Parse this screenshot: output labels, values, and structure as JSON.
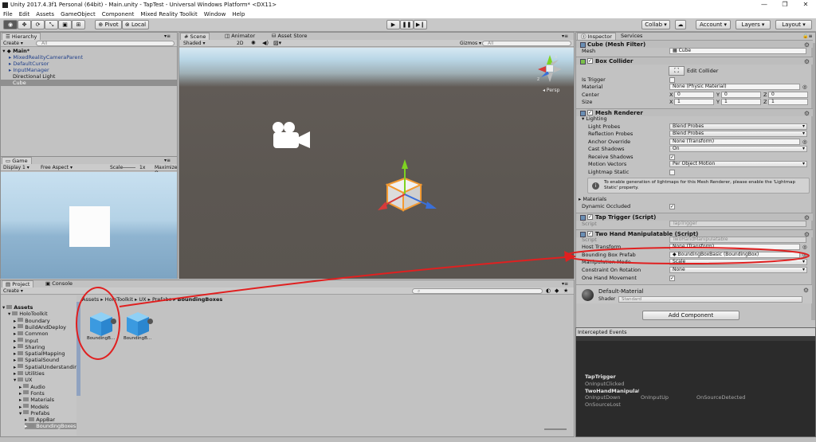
{
  "window": {
    "title": "Unity 2017.4.3f1 Personal (64bit) - Main.unity - TapTest - Universal Windows Platform* <DX11>",
    "minimize": "—",
    "maximize": "❐",
    "close": "✕"
  },
  "menu": [
    "File",
    "Edit",
    "Assets",
    "GameObject",
    "Component",
    "Mixed Reality Toolkit",
    "Window",
    "Help"
  ],
  "toolbar": {
    "pivot": "Pivot",
    "local": "Local",
    "collab": "Collab ▾",
    "account": "Account ▾",
    "layers": "Layers ▾",
    "layout": "Layout ▾"
  },
  "hierarchy": {
    "tab": "Hierarchy",
    "create": "Create ▾",
    "search": "All",
    "scene": "Main*",
    "items": [
      "MixedRealityCameraParent",
      "DefaultCursor",
      "InputManager",
      "Directional Light",
      "Cube"
    ]
  },
  "scene": {
    "tabs": [
      "Scene",
      "Animator",
      "Asset Store"
    ],
    "shading": "Shaded",
    "mode2d": "2D",
    "gizmos": "Gizmos ▾",
    "search": "All",
    "persp": "Persp",
    "gizmo_x": "x",
    "gizmo_z": "z"
  },
  "game": {
    "tab": "Game",
    "display": "Display 1",
    "aspect": "Free Aspect",
    "scale_label": "Scale",
    "scale_value": "1x",
    "maximize": "Maximize O"
  },
  "project": {
    "tabs": [
      "Project",
      "Console"
    ],
    "create": "Create ▾",
    "breadcrumb": [
      "Assets",
      "HoloToolkit",
      "UX",
      "Prefabs",
      "BoundingBoxes"
    ],
    "tree": [
      {
        "label": "Assets",
        "indent": 0,
        "bold": true,
        "expanded": true
      },
      {
        "label": "HoloToolkit",
        "indent": 1,
        "expanded": true
      },
      {
        "label": "Boundary",
        "indent": 2
      },
      {
        "label": "BuildAndDeploy",
        "indent": 2
      },
      {
        "label": "Common",
        "indent": 2
      },
      {
        "label": "Input",
        "indent": 2
      },
      {
        "label": "Sharing",
        "indent": 2
      },
      {
        "label": "SpatialMapping",
        "indent": 2
      },
      {
        "label": "SpatialSound",
        "indent": 2
      },
      {
        "label": "SpatialUnderstandin",
        "indent": 2
      },
      {
        "label": "Utilities",
        "indent": 2
      },
      {
        "label": "UX",
        "indent": 2,
        "expanded": true
      },
      {
        "label": "Audio",
        "indent": 3
      },
      {
        "label": "Fonts",
        "indent": 3
      },
      {
        "label": "Materials",
        "indent": 3
      },
      {
        "label": "Models",
        "indent": 3
      },
      {
        "label": "Prefabs",
        "indent": 3,
        "expanded": true
      },
      {
        "label": "AppBar",
        "indent": 4
      },
      {
        "label": "BoundingBoxes",
        "indent": 4,
        "selected": true
      }
    ],
    "assets": [
      {
        "label": "BoundingB..."
      },
      {
        "label": "BoundingB..."
      }
    ]
  },
  "inspector": {
    "tabs": [
      "Inspector",
      "Services"
    ],
    "mesh_filter": {
      "title": "Cube (Mesh Filter)",
      "mesh_label": "Mesh",
      "mesh_value": "Cube"
    },
    "box_collider": {
      "title": "Box Collider",
      "edit_collider": "Edit Collider",
      "is_trigger": "Is Trigger",
      "material_label": "Material",
      "material_value": "None (Physic Material)",
      "center_label": "Center",
      "size_label": "Size",
      "center": [
        "0",
        "0",
        "0"
      ],
      "size": [
        "1",
        "1",
        "1"
      ],
      "axis": [
        "X",
        "Y",
        "Z"
      ]
    },
    "mesh_renderer": {
      "title": "Mesh Renderer",
      "lighting": "Lighting",
      "light_probes": "Light Probes",
      "light_probes_value": "Blend Probes",
      "reflection_probes": "Reflection Probes",
      "reflection_probes_value": "Blend Probes",
      "anchor_override": "Anchor Override",
      "anchor_override_value": "None (Transform)",
      "cast_shadows": "Cast Shadows",
      "cast_shadows_value": "On",
      "receive_shadows": "Receive Shadows",
      "motion_vectors": "Motion Vectors",
      "motion_vectors_value": "Per Object Motion",
      "lightmap_static": "Lightmap Static",
      "info": "To enable generation of lightmaps for this Mesh Renderer, please enable the 'Lightmap Static' property.",
      "materials": "Materials",
      "dynamic_occluded": "Dynamic Occluded"
    },
    "tap_trigger": {
      "title": "Tap Trigger (Script)",
      "script_label": "Script",
      "script_value": "TapTrigger"
    },
    "two_hand": {
      "title": "Two Hand Manipulatable (Script)",
      "script_label": "Script",
      "script_value": "TwoHandManipulatable",
      "host_transform": "Host Transform",
      "host_transform_value": "None (Transform)",
      "bbox_prefab": "Bounding Box Prefab",
      "bbox_prefab_value": "BoundingBoxBasic (BoundingBox)",
      "manip_mode": "Manipulation Mode",
      "manip_mode_value": "Scale",
      "constraint": "Constraint On Rotation",
      "constraint_value": "None",
      "one_hand": "One Hand Movement"
    },
    "material": {
      "name": "Default-Material",
      "shader_label": "Shader",
      "shader_value": "Standard"
    },
    "add_component": "Add Component"
  },
  "intercepted": {
    "title": "Intercepted Events",
    "groups": [
      {
        "name": "TapTrigger",
        "events": [
          "OnInputClicked"
        ]
      },
      {
        "name": "TwoHandManipulatable",
        "events": [
          "OnInputDown",
          "OnInputUp",
          "OnSourceDetected",
          "OnSourceLost"
        ]
      }
    ]
  },
  "colors": {
    "annotation": "#e02020",
    "selection": "#3e7ad8",
    "scene_bg": "#5a5550",
    "sky": "#bcd6e8"
  }
}
